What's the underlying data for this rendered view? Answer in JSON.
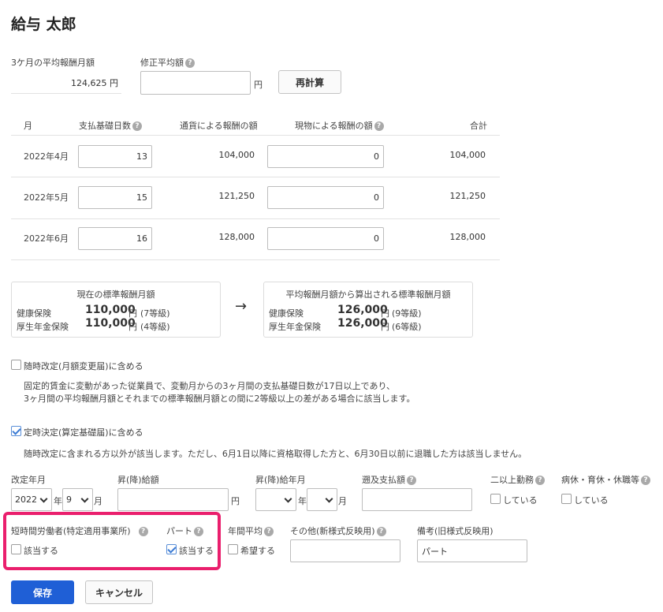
{
  "header": {
    "employee_name": "給与 太郎"
  },
  "summary": {
    "avg_label": "3ケ月の平均報酬月額",
    "avg_value": "124,625 円",
    "corrected_label": "修正平均額",
    "corrected_value": "",
    "yen": "円",
    "recalc_label": "再計算"
  },
  "table": {
    "headers": [
      "月",
      "支払基礎日数",
      "通貨による報酬の額",
      "現物による報酬の額",
      "合計"
    ],
    "rows": [
      {
        "month": "2022年4月",
        "days": "13",
        "cash": "104,000",
        "in_kind": "0",
        "total": "104,000"
      },
      {
        "month": "2022年5月",
        "days": "15",
        "cash": "121,250",
        "in_kind": "0",
        "total": "121,250"
      },
      {
        "month": "2022年6月",
        "days": "16",
        "cash": "128,000",
        "in_kind": "0",
        "total": "128,000"
      }
    ]
  },
  "current_box": {
    "title": "現在の標準報酬月額",
    "health_label": "健康保険",
    "health_amount": "110,000",
    "health_unit": "円",
    "health_grade": "(7等級)",
    "pension_label": "厚生年金保険",
    "pension_amount": "110,000",
    "pension_unit": "円",
    "pension_grade": "(4等級)"
  },
  "arrow": "→",
  "new_box": {
    "title": "平均報酬月額から算出される標準報酬月額",
    "health_label": "健康保険",
    "health_amount": "126,000",
    "health_unit": "円",
    "health_grade": "(9等級)",
    "pension_label": "厚生年金保険",
    "pension_amount": "126,000",
    "pension_unit": "円",
    "pension_grade": "(6等級)"
  },
  "adhoc": {
    "checked": false,
    "label": "随時改定(月額変更届)に含める",
    "desc1": "固定的賃金に変動があった従業員で、変動月からの3ヶ月間の支払基礎日数が17日以上であり、",
    "desc2": "3ヶ月間の平均報酬月額とそれまでの標準報酬月額との間に2等級以上の差がある場合に該当します。"
  },
  "regular": {
    "checked": true,
    "label": "定時決定(算定基礎届)に含める",
    "desc": "随時改定に含まれる方以外が該当します。ただし、6月1日以降に資格取得した方と、6月30日以前に退職した方は該当しません。"
  },
  "fields": {
    "revision_label": "改定年月",
    "revision_year": "2022",
    "year_unit": "年",
    "revision_month": "9",
    "month_unit": "月",
    "raise_amount_label": "昇(降)給額",
    "raise_amount_value": "",
    "yen": "円",
    "raise_month_label": "昇(降)給年月",
    "raise_year": "",
    "raise_month": "",
    "retro_label": "遡及支払額",
    "retro_value": "",
    "multi_label": "二以上勤務",
    "multi_option": "している",
    "leave_label": "病休・育休・休職等",
    "leave_option": "している"
  },
  "fields2": {
    "short_label": "短時間労働者(特定適用事業所)",
    "short_option": "該当する",
    "part_label": "パート",
    "part_option": "該当する",
    "annual_label": "年間平均",
    "annual_option": "希望する",
    "other_label": "その他(新様式反映用)",
    "other_value": "",
    "note_label": "備考(旧様式反映用)",
    "note_value": "パート"
  },
  "actions": {
    "save_label": "保存",
    "cancel_label": "キャンセル"
  },
  "colors": {
    "primary": "#1f5fd6",
    "highlight": "#ea1f6d",
    "check": "#3b7bd4"
  }
}
